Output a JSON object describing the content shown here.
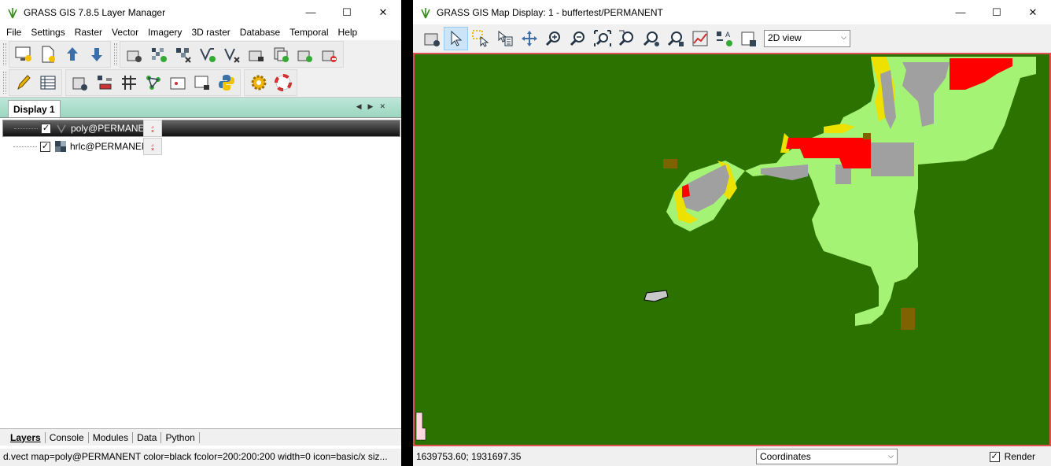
{
  "layer_manager": {
    "title": "GRASS GIS 7.8.5 Layer Manager",
    "menu": [
      "File",
      "Settings",
      "Raster",
      "Vector",
      "Imagery",
      "3D raster",
      "Database",
      "Temporal",
      "Help"
    ],
    "display_tab": "Display 1",
    "layers": [
      {
        "name": "poly@PERMANENT",
        "checked": true,
        "selected": true,
        "icon": "vector-layer-icon"
      },
      {
        "name": "hrlc@PERMANENT",
        "checked": true,
        "selected": false,
        "icon": "raster-layer-icon"
      }
    ],
    "bottom_tabs": [
      "Layers",
      "Console",
      "Modules",
      "Data",
      "Python"
    ],
    "active_bottom_tab": "Layers",
    "status": "d.vect map=poly@PERMANENT color=black fcolor=200:200:200 width=0 icon=basic/x siz..."
  },
  "map_display": {
    "title": "GRASS GIS Map Display: 1 - buffertest/PERMANENT",
    "view_mode": "2D view",
    "coordinates": "1639753.60; 1931697.35",
    "status_mode": "Coordinates",
    "render_label": "Render",
    "render_checked": true
  },
  "colors": {
    "map_background": "#2b7200",
    "light_green": "#a4f374",
    "gray": "#a0a0a0",
    "red": "#ff0000",
    "yellow": "#ede100",
    "brown": "#7d6400"
  }
}
